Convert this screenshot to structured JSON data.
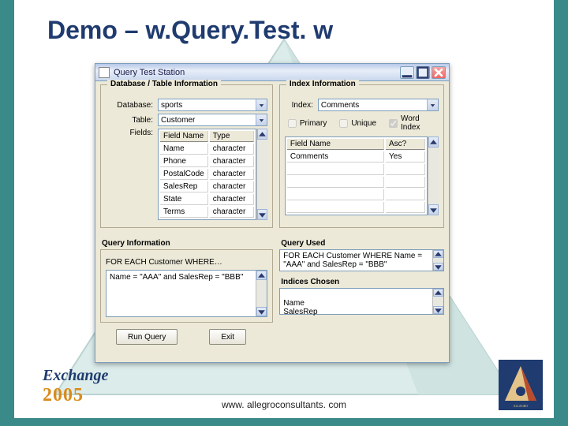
{
  "slide": {
    "title": "Demo – w.Query.Test. w",
    "footer_url": "www. allegroconsultants. com",
    "exchange_text": "Exchange",
    "exchange_year": "2005"
  },
  "window": {
    "title": "Query Test Station",
    "db_group_title": "Database / Table Information",
    "idx_group_title": "Index Information",
    "labels": {
      "database": "Database:",
      "table": "Table:",
      "fields": "Fields:",
      "index": "Index:"
    },
    "database_value": "sports",
    "table_value": "Customer",
    "index_value": "Comments",
    "checkboxes": {
      "primary": "Primary",
      "unique": "Unique",
      "wordindex": "Word Index"
    },
    "field_grid": {
      "headers": [
        "Field Name",
        "Type"
      ],
      "rows": [
        [
          "Name",
          "character"
        ],
        [
          "Phone",
          "character"
        ],
        [
          "PostalCode",
          "character"
        ],
        [
          "SalesRep",
          "character"
        ],
        [
          "State",
          "character"
        ],
        [
          "Terms",
          "character"
        ]
      ]
    },
    "index_grid": {
      "headers": [
        "Field Name",
        "Asc?"
      ],
      "rows": [
        [
          "Comments",
          "Yes"
        ]
      ]
    },
    "query_info_title": "Query Information",
    "for_each_label": "FOR EACH Customer WHERE…",
    "query_text": "Name = \"AAA\" and SalesRep = \"BBB\"",
    "query_used_title": "Query Used",
    "query_used_text": "FOR EACH Customer WHERE Name = \"AAA\" and SalesRep = \"BBB\"",
    "indices_chosen_title": "Indices Chosen",
    "indices_chosen_text": "Name\nSalesRep",
    "buttons": {
      "run": "Run Query",
      "exit": "Exit"
    }
  }
}
